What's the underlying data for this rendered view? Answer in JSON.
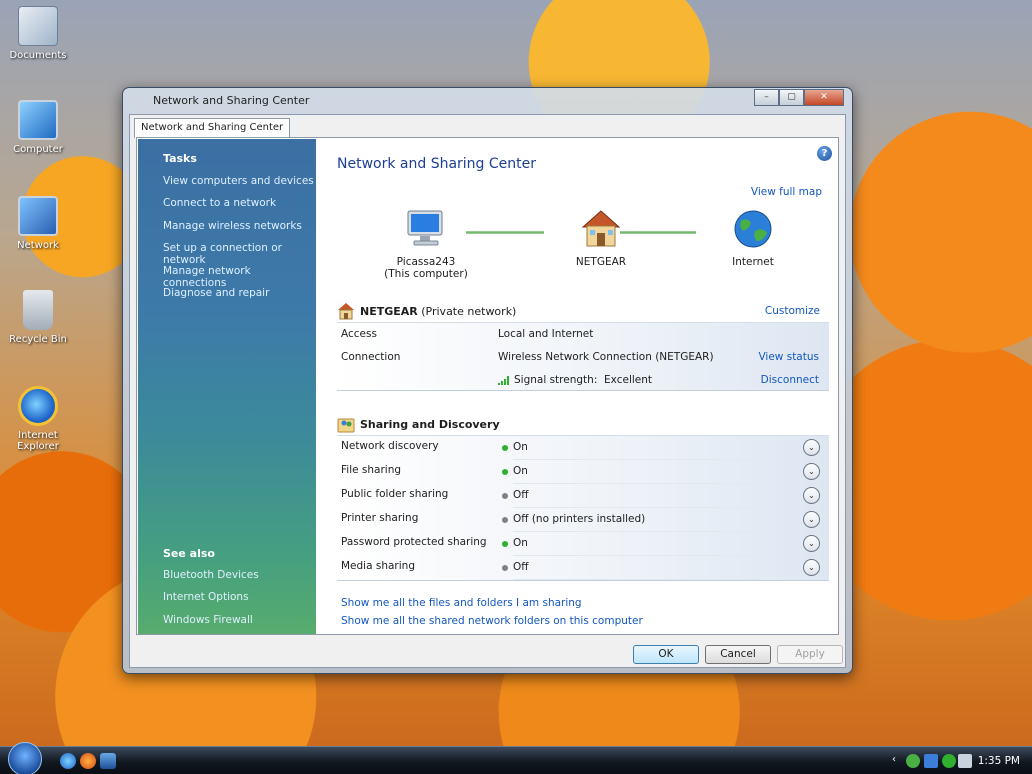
{
  "desktop": {
    "icons": [
      {
        "label": "Documents"
      },
      {
        "label": "Computer"
      },
      {
        "label": "Network"
      },
      {
        "label": "Recycle Bin"
      },
      {
        "label": "Internet Explorer"
      }
    ]
  },
  "window": {
    "title": "Network and Sharing Center",
    "controls": {
      "minimize": "–",
      "maximize": "▢",
      "close": "✕"
    },
    "tab_label": "Network and Sharing Center"
  },
  "left_pane": {
    "tasks_heading": "Tasks",
    "tasks": [
      "View computers and devices",
      "Connect to a network",
      "Manage wireless networks",
      "Set up a connection or network",
      "Manage network connections",
      "Diagnose and repair"
    ],
    "see_also_heading": "See also",
    "see_also": [
      "Bluetooth Devices",
      "Internet Options",
      "Windows Firewall"
    ]
  },
  "main": {
    "title": "Network and Sharing Center",
    "help": "?",
    "view_full_map": "View full map",
    "map": {
      "computer_name": "Picassa243",
      "computer_sub": "(This computer)",
      "router": "NETGEAR",
      "internet": "Internet"
    },
    "network": {
      "name": "NETGEAR",
      "type": "(Private network)",
      "customize": "Customize",
      "access_label": "Access",
      "access_value": "Local and Internet",
      "connection_label": "Connection",
      "connection_value": "Wireless Network Connection (NETGEAR)",
      "view_status": "View status",
      "signal_label": "Signal strength:",
      "signal_value": "Excellent",
      "disconnect": "Disconnect"
    },
    "sharing": {
      "heading": "Sharing and Discovery",
      "rows": [
        {
          "label": "Network discovery",
          "value": "On",
          "on": true
        },
        {
          "label": "File sharing",
          "value": "On",
          "on": true
        },
        {
          "label": "Public folder sharing",
          "value": "Off",
          "on": false
        },
        {
          "label": "Printer sharing",
          "value": "Off (no printers installed)",
          "on": false
        },
        {
          "label": "Password protected sharing",
          "value": "On",
          "on": true
        },
        {
          "label": "Media sharing",
          "value": "Off",
          "on": false
        }
      ],
      "expand_glyph": "⌄",
      "link_files": "Show me all the files and folders I am sharing",
      "link_folders": "Show me all the shared network folders on this computer"
    },
    "colors": {
      "on_dot": "#2fae2f",
      "off_dot": "#808080"
    }
  },
  "buttons": {
    "ok": "OK",
    "cancel": "Cancel",
    "apply": "Apply"
  },
  "taskbar": {
    "clock": "1:35 PM"
  }
}
